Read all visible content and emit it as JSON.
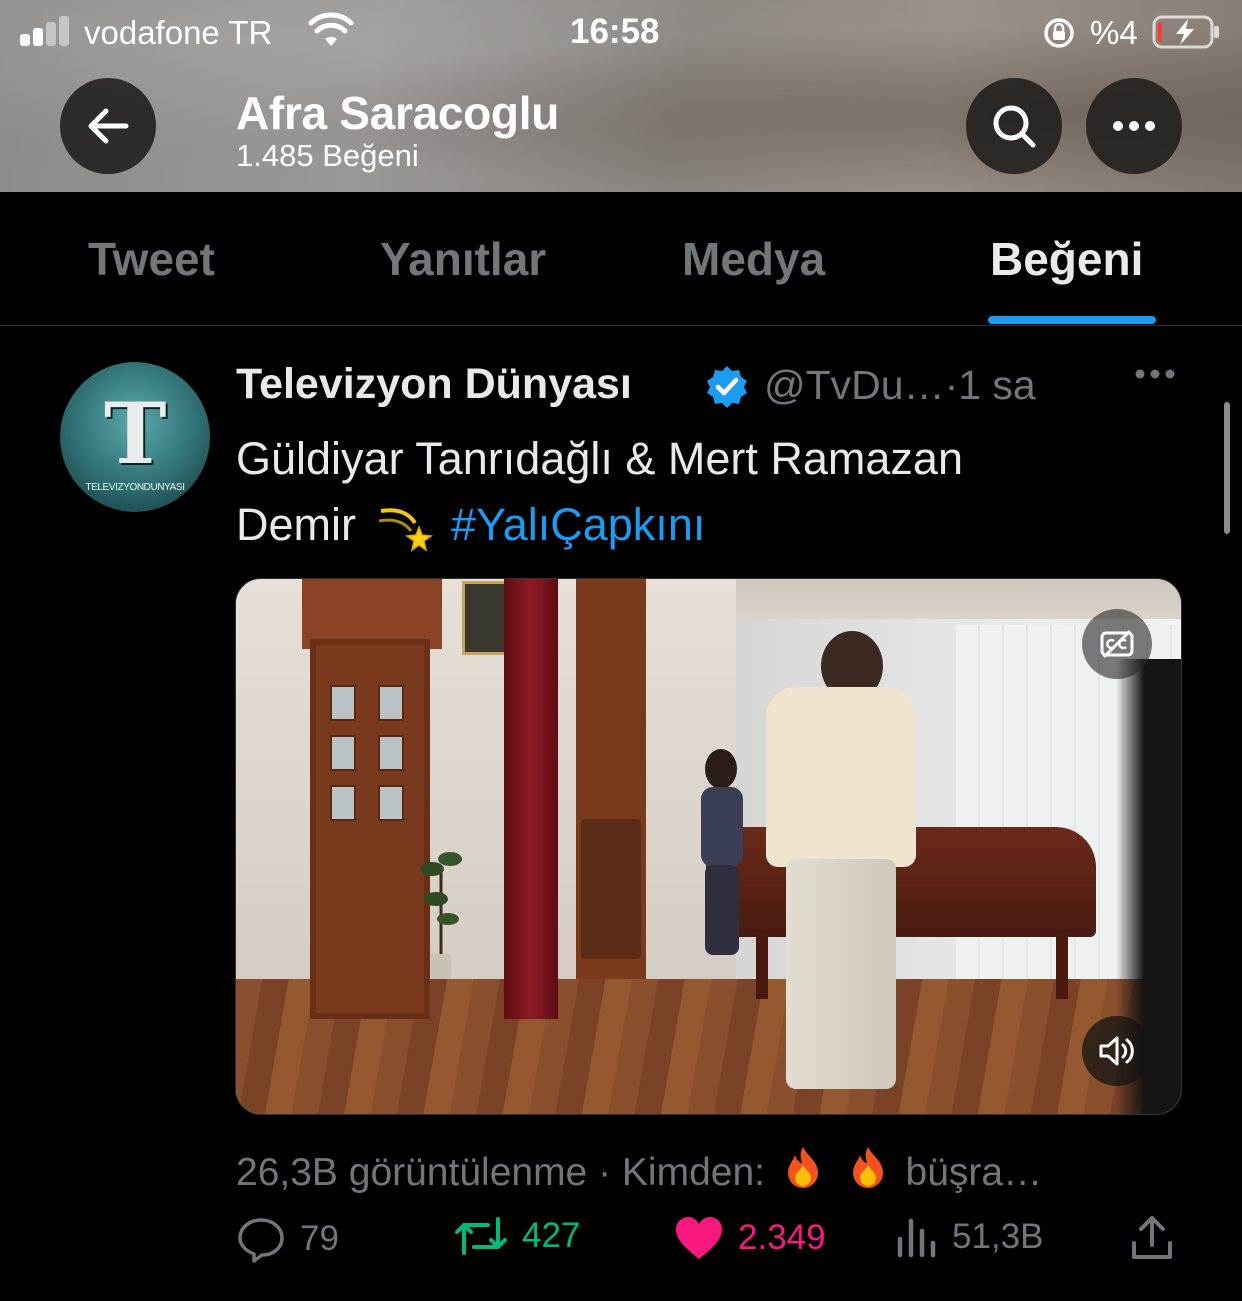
{
  "status_bar": {
    "carrier": "vodafone TR",
    "time": "16:58",
    "battery_percent": "%4",
    "signal_bars": 2,
    "icons": [
      "signal-icon",
      "wifi-icon",
      "orientation-lock-icon",
      "battery-charging-icon"
    ]
  },
  "profile": {
    "name": "Afra Saracoglu",
    "likes_count": "1.485 Beğeni"
  },
  "tabs": [
    {
      "label": "Tweet"
    },
    {
      "label": "Yanıtlar"
    },
    {
      "label": "Medya"
    },
    {
      "label": "Beğeni",
      "active": true
    }
  ],
  "tweet": {
    "author_name": "Televizyon Dünyası",
    "handle": "@TvDu…",
    "time": "·1 sa",
    "avatar_text": "TELEVIZYONDUNYASI",
    "avatar_letter": "T",
    "text_line1": "Güldiyar Tanrıdağlı & Mert Ramazan",
    "text_line2_start": "Demir",
    "hashtag": "#YalıÇapkını",
    "meta_views": "26,3B görüntülenme · Kimden:",
    "meta_source": "büşra…",
    "stats": {
      "replies": "79",
      "retweets": "427",
      "likes": "2.349",
      "views": "51,3B"
    }
  },
  "colors": {
    "accent": "#1d9bf0",
    "retweet": "#00ba7c",
    "like": "#f91880",
    "muted": "#71767b",
    "background": "#000000"
  }
}
